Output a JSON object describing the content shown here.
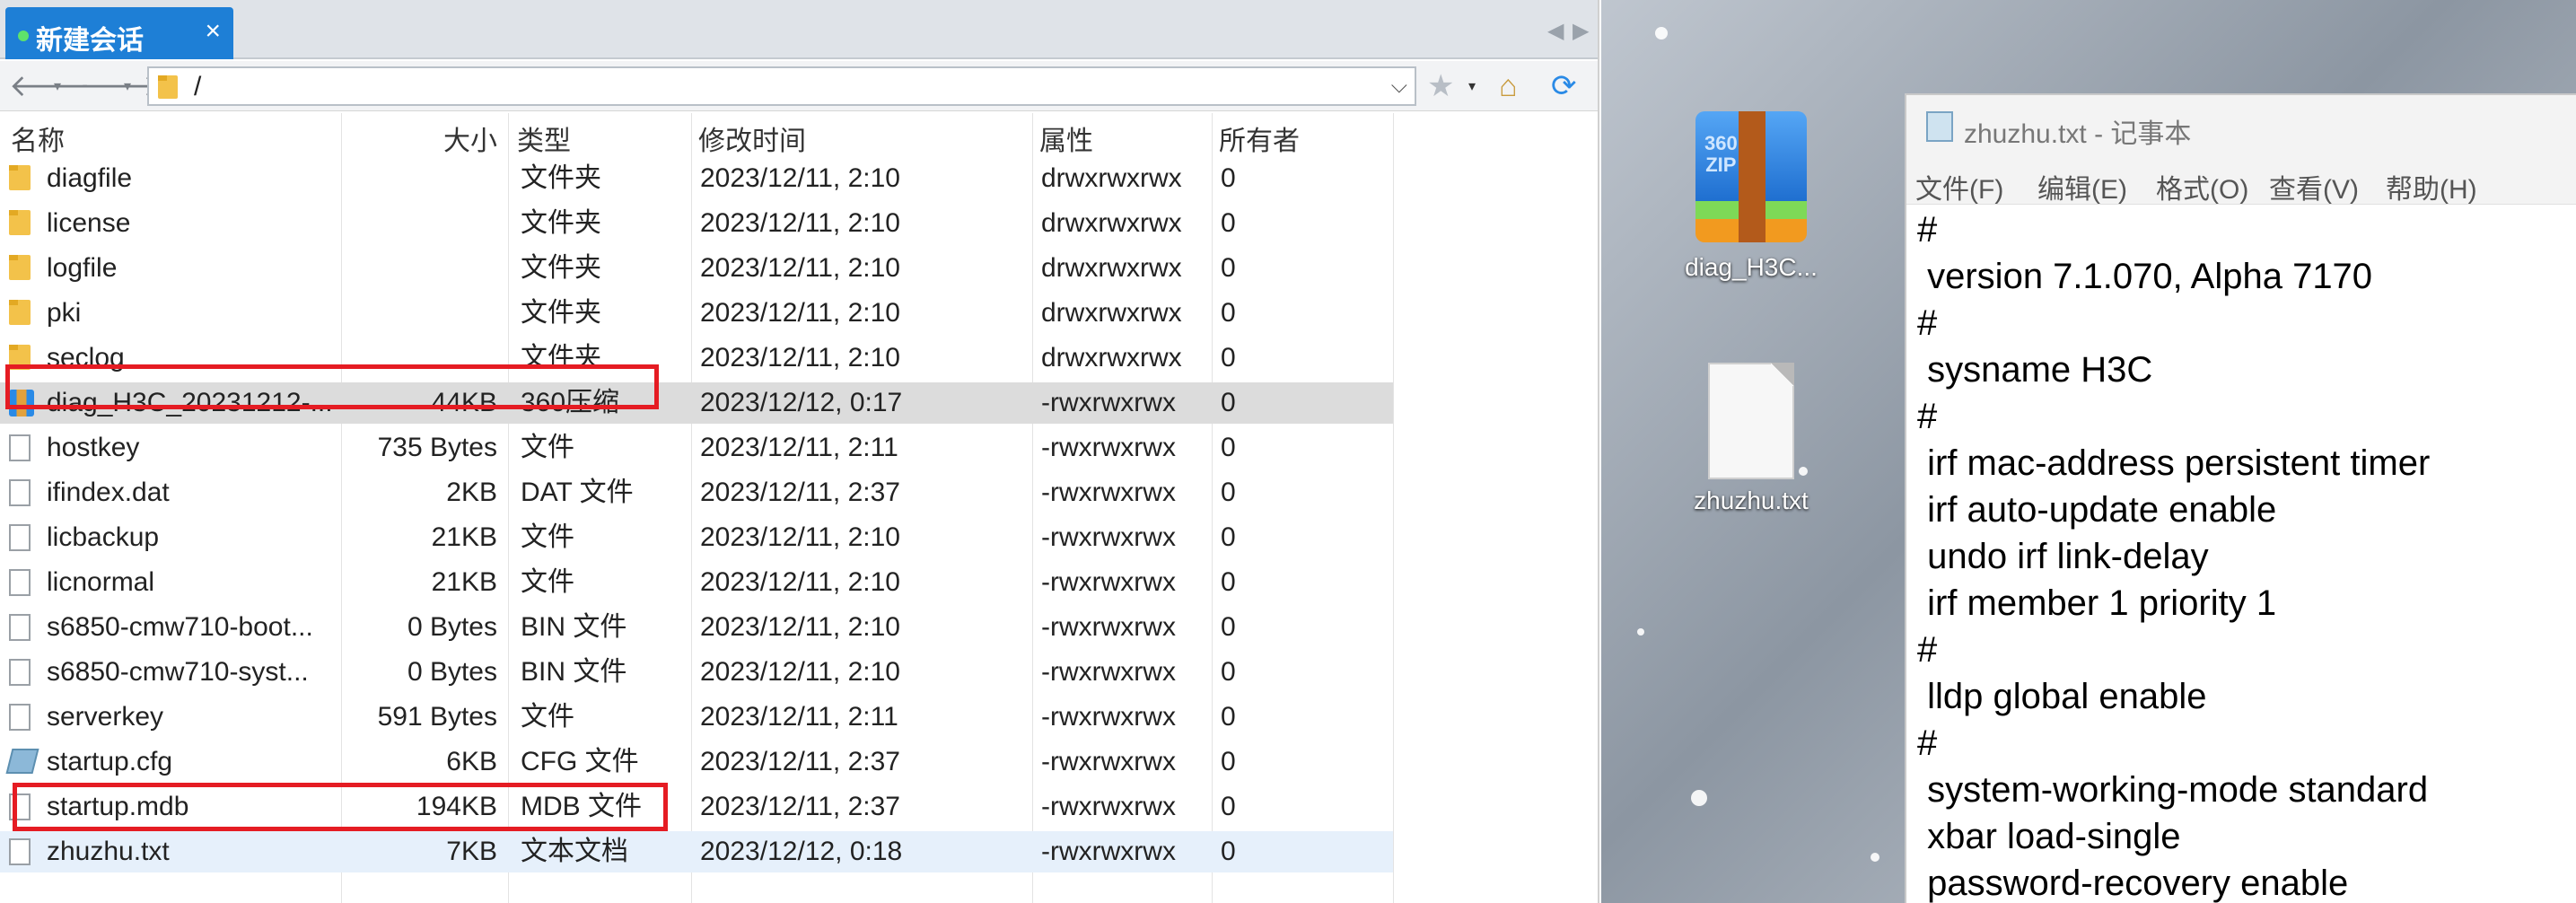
{
  "sftp": {
    "tab": {
      "label": "新建会话",
      "close": "×"
    },
    "tab_scroll": {
      "left": "◀",
      "right": "▶"
    },
    "nav": {
      "back": "🡐",
      "forward": "🡒",
      "caret": "▾",
      "path": "/",
      "path_dropdown": "⌵",
      "star": "★",
      "home": "⌂",
      "refresh": "⟳"
    },
    "columns": {
      "name": "名称",
      "size": "大小",
      "type": "类型",
      "mtime": "修改时间",
      "attr": "属性",
      "owner": "所有者"
    },
    "sort_indicator": "^",
    "files": [
      {
        "icon": "folder-icon",
        "name": "diagfile",
        "size": "",
        "type": "文件夹",
        "mtime": "2023/12/11, 2:10",
        "attr": "drwxrwxrwx",
        "owner": "0"
      },
      {
        "icon": "folder-icon",
        "name": "license",
        "size": "",
        "type": "文件夹",
        "mtime": "2023/12/11, 2:10",
        "attr": "drwxrwxrwx",
        "owner": "0"
      },
      {
        "icon": "folder-icon",
        "name": "logfile",
        "size": "",
        "type": "文件夹",
        "mtime": "2023/12/11, 2:10",
        "attr": "drwxrwxrwx",
        "owner": "0"
      },
      {
        "icon": "folder-icon",
        "name": "pki",
        "size": "",
        "type": "文件夹",
        "mtime": "2023/12/11, 2:10",
        "attr": "drwxrwxrwx",
        "owner": "0"
      },
      {
        "icon": "folder-icon",
        "name": "seclog",
        "size": "",
        "type": "文件夹",
        "mtime": "2023/12/11, 2:10",
        "attr": "drwxrwxrwx",
        "owner": "0"
      },
      {
        "icon": "zip-icon",
        "name": "diag_H3C_20231212-...",
        "size": "44KB",
        "type": "360压缩",
        "mtime": "2023/12/12, 0:17",
        "attr": "-rwxrwxrwx",
        "owner": "0"
      },
      {
        "icon": "file-icon",
        "name": "hostkey",
        "size": "735 Bytes",
        "type": "文件",
        "mtime": "2023/12/11, 2:11",
        "attr": "-rwxrwxrwx",
        "owner": "0"
      },
      {
        "icon": "file-icon",
        "name": "ifindex.dat",
        "size": "2KB",
        "type": "DAT 文件",
        "mtime": "2023/12/11, 2:37",
        "attr": "-rwxrwxrwx",
        "owner": "0"
      },
      {
        "icon": "file-icon",
        "name": "licbackup",
        "size": "21KB",
        "type": "文件",
        "mtime": "2023/12/11, 2:10",
        "attr": "-rwxrwxrwx",
        "owner": "0"
      },
      {
        "icon": "file-icon",
        "name": "licnormal",
        "size": "21KB",
        "type": "文件",
        "mtime": "2023/12/11, 2:10",
        "attr": "-rwxrwxrwx",
        "owner": "0"
      },
      {
        "icon": "file-icon",
        "name": "s6850-cmw710-boot...",
        "size": "0 Bytes",
        "type": "BIN 文件",
        "mtime": "2023/12/11, 2:10",
        "attr": "-rwxrwxrwx",
        "owner": "0"
      },
      {
        "icon": "file-icon",
        "name": "s6850-cmw710-syst...",
        "size": "0 Bytes",
        "type": "BIN 文件",
        "mtime": "2023/12/11, 2:10",
        "attr": "-rwxrwxrwx",
        "owner": "0"
      },
      {
        "icon": "file-icon",
        "name": "serverkey",
        "size": "591 Bytes",
        "type": "文件",
        "mtime": "2023/12/11, 2:11",
        "attr": "-rwxrwxrwx",
        "owner": "0"
      },
      {
        "icon": "cfg-icon",
        "name": "startup.cfg",
        "size": "6KB",
        "type": "CFG 文件",
        "mtime": "2023/12/11, 2:37",
        "attr": "-rwxrwxrwx",
        "owner": "0"
      },
      {
        "icon": "file-icon",
        "name": "startup.mdb",
        "size": "194KB",
        "type": "MDB 文件",
        "mtime": "2023/12/11, 2:37",
        "attr": "-rwxrwxrwx",
        "owner": "0"
      },
      {
        "icon": "file-icon",
        "name": "zhuzhu.txt",
        "size": "7KB",
        "type": "文本文档",
        "mtime": "2023/12/12, 0:18",
        "attr": "-rwxrwxrwx",
        "owner": "0"
      }
    ]
  },
  "desktop": {
    "icons": [
      {
        "label": "diag_H3C...",
        "kind": "zip",
        "badge": "360\nZIP"
      },
      {
        "label": "zhuzhu.txt",
        "kind": "txt"
      }
    ]
  },
  "notepad": {
    "title": "zhuzhu.txt - 记事本",
    "menu": [
      "文件(F)",
      "编辑(E)",
      "格式(O)",
      "查看(V)",
      "帮助(H)"
    ],
    "lines": [
      "#",
      " version 7.1.070, Alpha 7170",
      "#",
      " sysname H3C",
      "#",
      " irf mac-address persistent timer",
      " irf auto-update enable",
      " undo irf link-delay",
      " irf member 1 priority 1",
      "#",
      " lldp global enable",
      "#",
      " system-working-mode standard",
      " xbar load-single",
      " password-recovery enable"
    ]
  },
  "colors": {
    "tab_blue": "#1e7fd6",
    "highlight_red": "#e51c23",
    "row_selected": "#dcdcdc"
  }
}
